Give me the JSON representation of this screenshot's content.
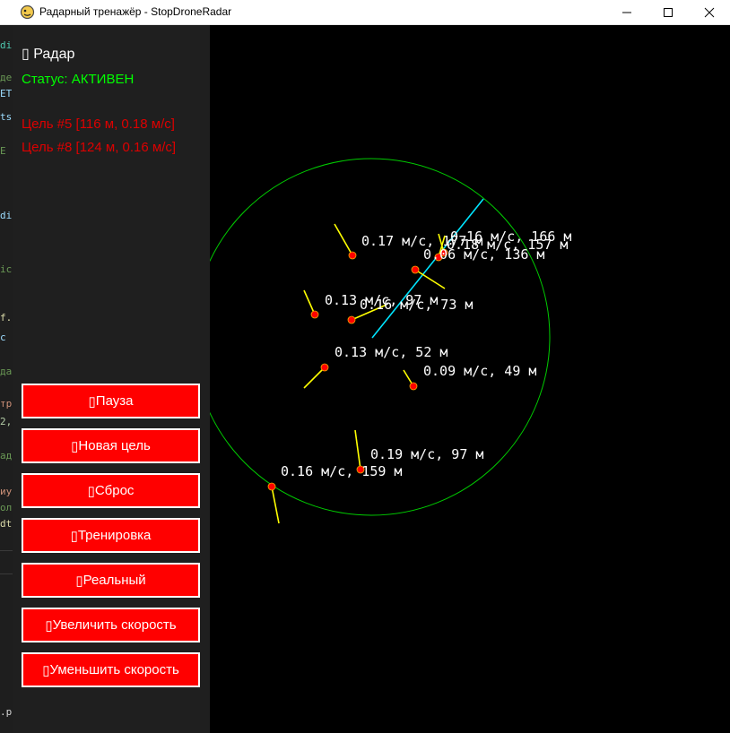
{
  "window": {
    "title": "Радарный тренажёр - StopDroneRadar",
    "controls": [
      "minimize",
      "maximize",
      "close"
    ]
  },
  "panel": {
    "title": "Радар",
    "status": "Статус: АКТИВЕН",
    "alerts": [
      "Цель #5 [116 м, 0.18 м/с]",
      "Цель #8 [124 м, 0.16 м/с]"
    ],
    "buttons": [
      {
        "label": "Пауза",
        "name": "pause-button"
      },
      {
        "label": "Новая цель",
        "name": "new-target-button"
      },
      {
        "label": "Сброс",
        "name": "reset-button"
      },
      {
        "label": "Тренировка",
        "name": "training-button"
      },
      {
        "label": "Реальный",
        "name": "real-mode-button"
      },
      {
        "label": "Увеличить скорость",
        "name": "increase-speed-button"
      },
      {
        "label": "Уменьшить скорость",
        "name": "decrease-speed-button"
      }
    ]
  },
  "radar": {
    "colors": {
      "background": "#000000",
      "range_ring": "#00cc00",
      "sweep": "#00e5ff",
      "target": "#ff0000",
      "heading": "#ffff00",
      "label": "#ffffff"
    },
    "targets": [
      {
        "label": "0.17 м/с, 177 м"
      },
      {
        "label": "0.16 м/с, 166 м"
      },
      {
        "label": "0.18 м/с, 157 м"
      },
      {
        "label": "0.06 м/с, 136 м"
      },
      {
        "label": "0.13 м/с, 97 м"
      },
      {
        "label": "0.16 м/с, 73 м"
      },
      {
        "label": "0.13 м/с, 52 м"
      },
      {
        "label": "0.09 м/с, 49 м"
      },
      {
        "label": "0.19 м/с, 97 м"
      },
      {
        "label": "0.16 м/с, 159 м"
      }
    ]
  },
  "icons": {
    "app": "pygame-snake-icon",
    "minimize": "minimize-icon",
    "maximize": "maximize-icon",
    "close": "close-icon"
  }
}
